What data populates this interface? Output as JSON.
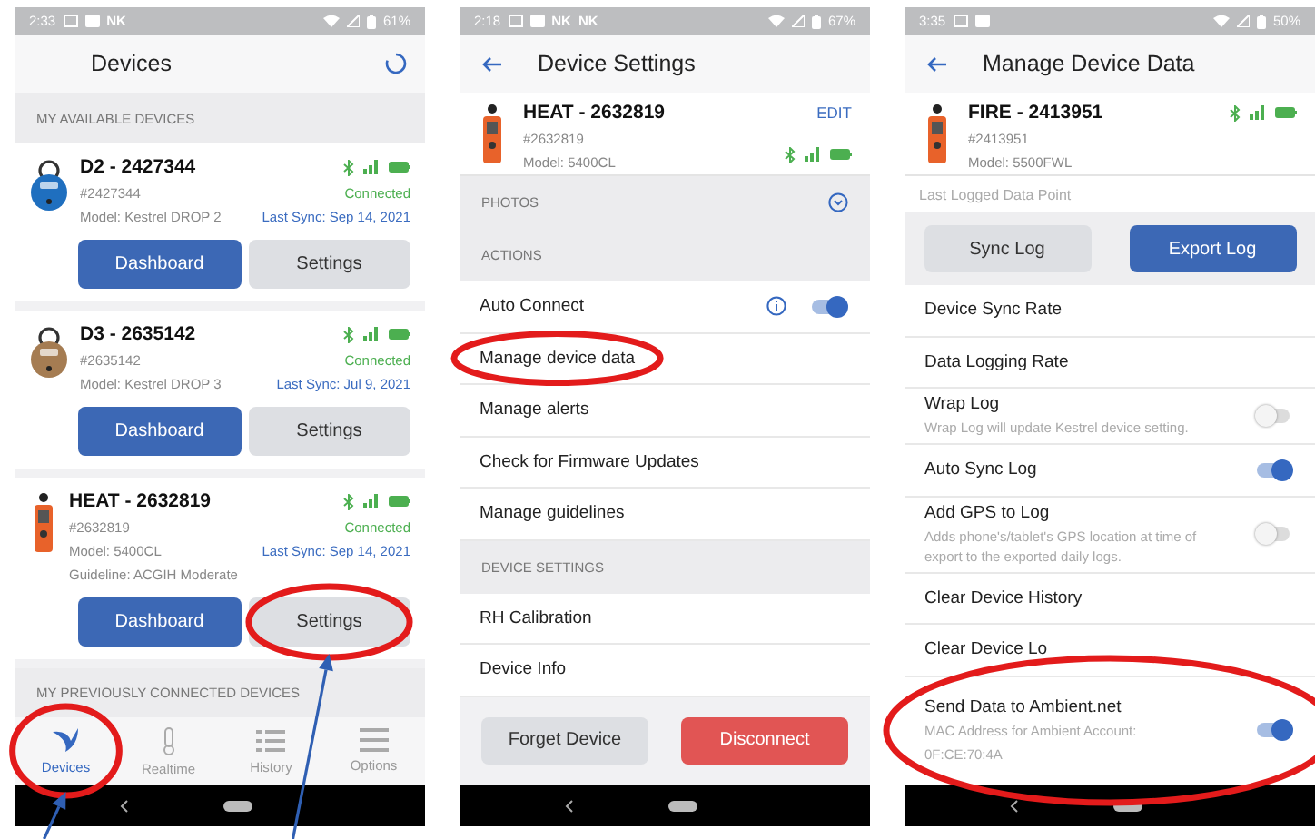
{
  "screens": [
    {
      "kind": "devices",
      "status_bar": {
        "time": "2:33",
        "labels": [
          "NK"
        ],
        "battery": "61%"
      },
      "title": "Devices",
      "section": "MY AVAILABLE DEVICES",
      "devices": [
        {
          "kind": "drop",
          "color": "#1f6fbf",
          "name": "D2 - 2427344",
          "serial": "#2427344",
          "lines": [
            "Model: Kestrel DROP 2"
          ],
          "status": "Connected",
          "last_sync": "Last Sync: Sep 14, 2021",
          "buttons": [
            {
              "kind": "primary",
              "label": "Dashboard"
            },
            {
              "kind": "secondary",
              "label": "Settings"
            }
          ]
        },
        {
          "kind": "drop",
          "color": "#a57c52",
          "name": "D3 - 2635142",
          "serial": "#2635142",
          "lines": [
            "Model: Kestrel DROP 3"
          ],
          "status": "Connected",
          "last_sync": "Last Sync: Jul 9, 2021",
          "buttons": [
            {
              "kind": "primary",
              "label": "Dashboard"
            },
            {
              "kind": "secondary",
              "label": "Settings"
            }
          ]
        },
        {
          "kind": "meter",
          "color": "#e8622a",
          "name": "HEAT - 2632819",
          "serial": "#2632819",
          "lines": [
            "Model: 5400CL",
            "Guideline: ACGIH Moderate"
          ],
          "status": "Connected",
          "last_sync": "Last Sync: Sep 14, 2021",
          "buttons": [
            {
              "kind": "primary",
              "label": "Dashboard"
            },
            {
              "kind": "secondary",
              "label": "Settings",
              "circled": true,
              "arrow": true
            }
          ]
        }
      ],
      "previous_section": "MY PREVIOUSLY CONNECTED DEVICES",
      "tabs": [
        {
          "kind": "devices",
          "label": "Devices",
          "selected": true,
          "circled": true,
          "arrow": true
        },
        {
          "kind": "realtime",
          "label": "Realtime",
          "selected": false
        },
        {
          "kind": "history",
          "label": "History",
          "selected": false
        },
        {
          "kind": "options",
          "label": "Options",
          "selected": false
        }
      ]
    },
    {
      "kind": "device_settings",
      "status_bar": {
        "time": "2:18",
        "labels": [
          "NK",
          "NK"
        ],
        "battery": "67%"
      },
      "title": "Device Settings",
      "device": {
        "kind": "meter",
        "color": "#e8622a",
        "name": "HEAT - 2632819",
        "serial": "#2632819",
        "model": "Model: 5400CL",
        "edit": "EDIT"
      },
      "rows": [
        {
          "kind": "header",
          "label": "PHOTOS",
          "expandable": true
        },
        {
          "kind": "header",
          "label": "ACTIONS",
          "expandable": false
        },
        {
          "kind": "toggle",
          "label": "Auto Connect",
          "info": true,
          "on": true
        },
        {
          "kind": "link",
          "label": "Manage device data",
          "circled": true
        },
        {
          "kind": "link",
          "label": "Manage alerts"
        },
        {
          "kind": "link",
          "label": "Check for Firmware Updates"
        },
        {
          "kind": "link",
          "label": "Manage guidelines"
        },
        {
          "kind": "header",
          "label": "DEVICE SETTINGS",
          "expandable": false
        },
        {
          "kind": "link",
          "label": "RH Calibration"
        },
        {
          "kind": "link",
          "label": "Device Info"
        }
      ],
      "footer_buttons": [
        {
          "kind": "secondary",
          "label": "Forget Device"
        },
        {
          "kind": "danger",
          "label": "Disconnect"
        }
      ]
    },
    {
      "kind": "manage_data",
      "status_bar": {
        "time": "3:35",
        "battery": "50%"
      },
      "title": "Manage Device Data",
      "device": {
        "kind": "meter",
        "color": "#e8622a",
        "name": "FIRE - 2413951",
        "serial": "#2413951",
        "model": "Model: 5500FWL"
      },
      "note": "Last Logged Data Point",
      "action_buttons": [
        {
          "kind": "secondary",
          "label": "Sync Log"
        },
        {
          "kind": "primary",
          "label": "Export Log"
        }
      ],
      "rows": [
        {
          "kind": "link",
          "label": "Device Sync Rate"
        },
        {
          "kind": "link",
          "label": "Data Logging Rate"
        },
        {
          "kind": "toggle",
          "label": "Wrap Log",
          "notes": [
            "Wrap Log will update Kestrel device setting."
          ],
          "on": false
        },
        {
          "kind": "toggle",
          "label": "Auto Sync Log",
          "on": true
        },
        {
          "kind": "toggle",
          "label": "Add GPS to Log",
          "notes": [
            "Adds phone's/tablet's GPS location at time of export to the exported daily logs."
          ],
          "on": false
        },
        {
          "kind": "link",
          "label": "Clear Device History"
        },
        {
          "kind": "link",
          "label": "Clear Device Lo"
        },
        {
          "kind": "toggle",
          "label": "Send Data to Ambient.net",
          "notes": [
            "MAC Address for Ambient Account:",
            "0F:CE:70:4A"
          ],
          "on": true,
          "circled": true
        }
      ]
    }
  ]
}
